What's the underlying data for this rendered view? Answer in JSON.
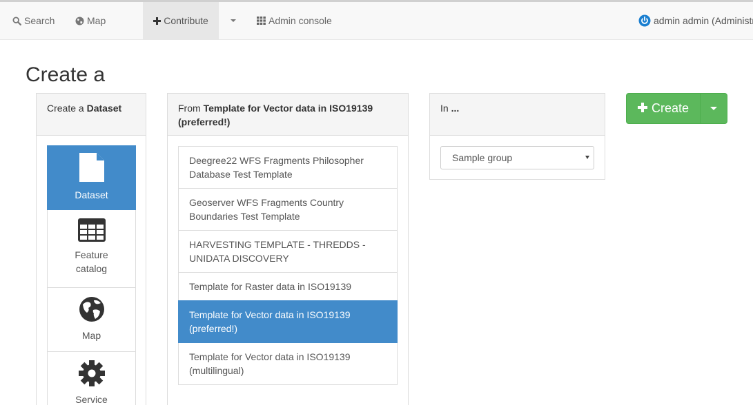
{
  "navbar": {
    "search_label": "Search",
    "map_label": "Map",
    "contribute_label": "Contribute",
    "admin_label": "Admin console",
    "user_label": "admin admin (Administrator)"
  },
  "page": {
    "title": "Create a"
  },
  "type_panel": {
    "heading_prefix": "Create a",
    "heading_value": "Dataset",
    "items": [
      {
        "label": "Dataset",
        "icon": "file-icon",
        "active": true
      },
      {
        "label": "Feature catalog",
        "icon": "table-icon",
        "active": false
      },
      {
        "label": "Map",
        "icon": "globe-icon",
        "active": false
      },
      {
        "label": "Service",
        "icon": "gear-icon",
        "active": false
      }
    ]
  },
  "template_panel": {
    "heading_prefix": "From",
    "heading_value": "Template for Vector data in ISO19139 (preferred!)",
    "items": [
      {
        "label": "Deegree22 WFS Fragments Philosopher Database Test Template"
      },
      {
        "label": "Geoserver WFS Fragments Country Boundaries Test Template"
      },
      {
        "label": "HARVESTING TEMPLATE - THREDDS - UNIDATA DISCOVERY"
      },
      {
        "label": "Template for Raster data in ISO19139"
      },
      {
        "label": "Template for Vector data in ISO19139 (preferred!)",
        "active": true
      },
      {
        "label": "Template for Vector data in ISO19139 (multilingual)"
      }
    ]
  },
  "group_panel": {
    "heading_prefix": "In",
    "heading_value": "...",
    "selected": "Sample group"
  },
  "create_button": {
    "label": "Create",
    "color": "#5cb85c"
  },
  "colors": {
    "active": "#428bca",
    "logout": "#1a7fd0"
  }
}
